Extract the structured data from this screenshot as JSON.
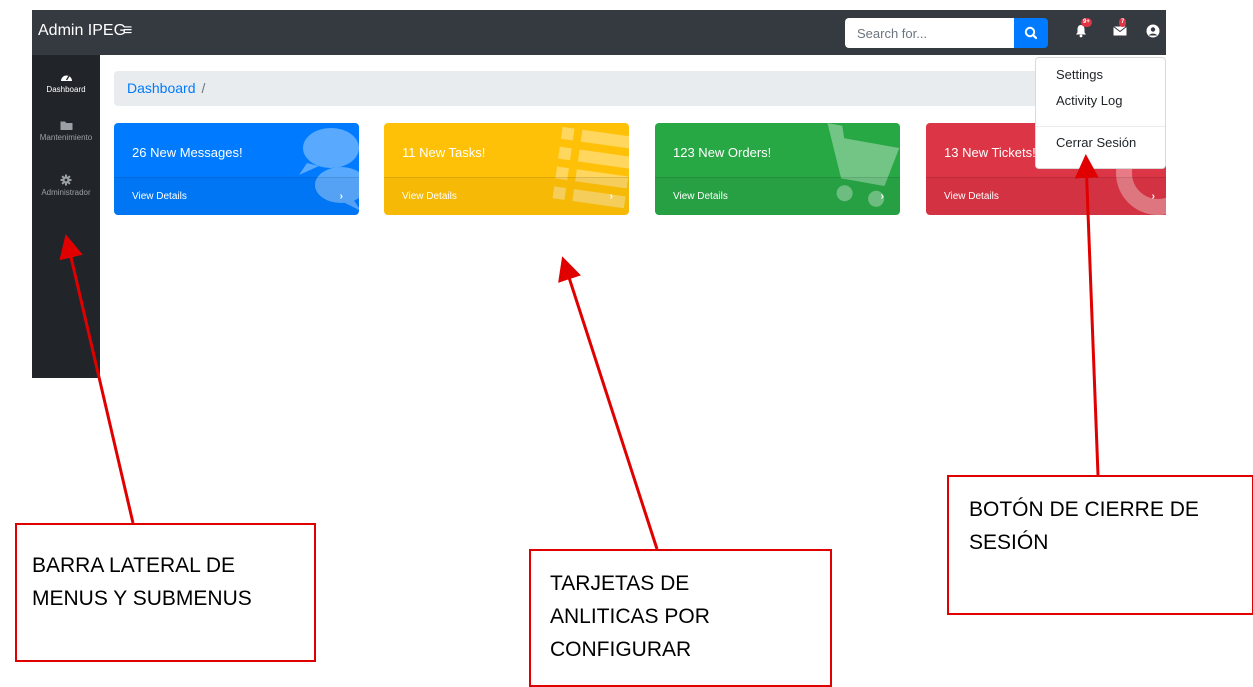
{
  "app": {
    "brand": "Admin IPEG"
  },
  "topbar": {
    "search_placeholder": "Search for...",
    "alerts_badge": "9+",
    "messages_badge": "7"
  },
  "sidebar": {
    "items": [
      {
        "label": "Dashboard",
        "icon": "tachometer-icon"
      },
      {
        "label": "Mantenimiento",
        "icon": "folder-icon"
      },
      {
        "label": "Administrador",
        "icon": "gear-icon"
      }
    ]
  },
  "breadcrumb": {
    "current": "Dashboard",
    "separator": "/"
  },
  "cards": [
    {
      "text": "26 New Messages!",
      "details": "View Details",
      "color": "#007bff",
      "icon": "comments-icon"
    },
    {
      "text": "11 New Tasks!",
      "details": "View Details",
      "color": "#ffc107",
      "icon": "list-icon"
    },
    {
      "text": "123 New Orders!",
      "details": "View Details",
      "color": "#28a745",
      "icon": "shopping-cart-icon"
    },
    {
      "text": "13 New Tickets!",
      "details": "View Details",
      "color": "#dc3545",
      "icon": "life-ring-icon"
    }
  ],
  "user_menu": {
    "settings": "Settings",
    "activity_log": "Activity Log",
    "logout": "Cerrar Sesión"
  },
  "annotations": {
    "sidebar_line1": "BARRA LATERAL DE",
    "sidebar_line2": "MENUS Y SUBMENUS",
    "cards_line1": "TARJETAS DE",
    "cards_line2": "ANLITICAS POR",
    "cards_line3": "CONFIGURAR",
    "logout_line1": "BOTÓN DE CIERRE DE",
    "logout_line2": "SESIÓN",
    "color": "#e00000"
  }
}
